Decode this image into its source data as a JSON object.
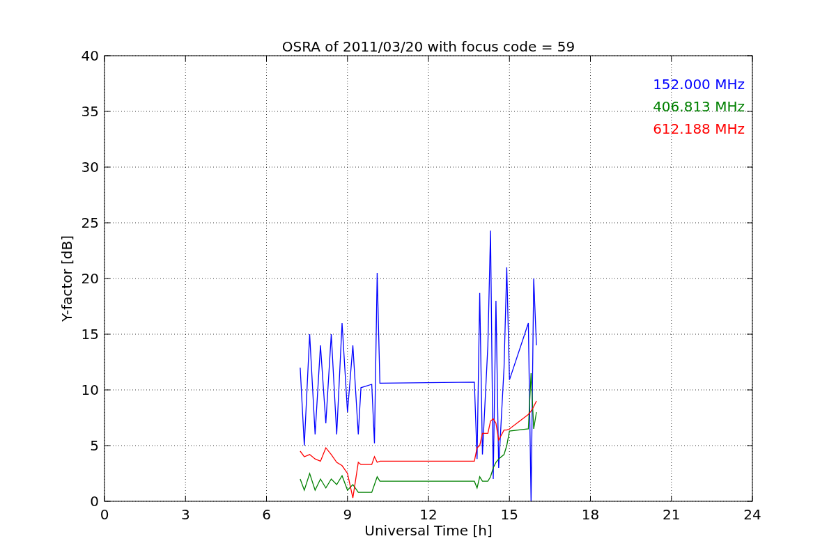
{
  "chart_data": {
    "type": "line",
    "title": "OSRA of 2011/03/20 with focus code = 59",
    "xlabel": "Universal Time [h]",
    "ylabel": "Y-factor [dB]",
    "x": [
      7.25,
      7.4,
      7.6,
      7.8,
      8.0,
      8.2,
      8.4,
      8.6,
      8.8,
      9.0,
      9.2,
      9.4,
      9.5,
      9.9,
      10.0,
      10.1,
      10.2,
      13.7,
      13.8,
      13.9,
      14.0,
      14.2,
      14.3,
      14.4,
      14.5,
      14.6,
      14.8,
      14.9,
      15.0,
      15.7,
      15.8,
      15.9,
      16.0
    ],
    "series": [
      {
        "name": "152.000 MHz",
        "color": "#0000ff",
        "values": [
          12,
          5,
          15,
          6,
          14,
          7,
          15,
          6,
          16,
          8,
          14,
          6,
          10.2,
          10.5,
          5.2,
          20.5,
          10.6,
          10.7,
          3.8,
          18.7,
          4.2,
          14,
          24.3,
          2,
          18,
          3,
          12,
          21,
          10.9,
          16,
          0,
          20,
          14
        ]
      },
      {
        "name": "406.813 MHz",
        "color": "#008000",
        "values": [
          2,
          1,
          2.5,
          1,
          2,
          1.2,
          2,
          1.5,
          2.3,
          1,
          1.5,
          0.8,
          0.8,
          0.8,
          1.5,
          2.2,
          1.8,
          1.8,
          1.2,
          2.2,
          1.8,
          1.8,
          2.2,
          3,
          3.5,
          3.8,
          4.2,
          5,
          6.3,
          6.5,
          11.5,
          6.5,
          8
        ]
      },
      {
        "name": "612.188 MHz",
        "color": "#ff0000",
        "values": [
          4.5,
          4,
          4.2,
          3.8,
          3.6,
          4.8,
          4.2,
          3.5,
          3.2,
          2.5,
          0.3,
          3.5,
          3.3,
          3.3,
          4,
          3.5,
          3.6,
          3.6,
          4.8,
          5,
          6.1,
          6.1,
          7.2,
          7.4,
          7,
          5.5,
          6.4,
          6.4,
          6.5,
          7.8,
          8.1,
          8.5,
          9
        ]
      }
    ],
    "xlim": [
      0,
      24
    ],
    "ylim": [
      0,
      40
    ],
    "xticks": [
      0,
      3,
      6,
      9,
      12,
      15,
      18,
      21,
      24
    ],
    "yticks": [
      0,
      5,
      10,
      15,
      20,
      25,
      30,
      35,
      40
    ],
    "grid": true
  }
}
